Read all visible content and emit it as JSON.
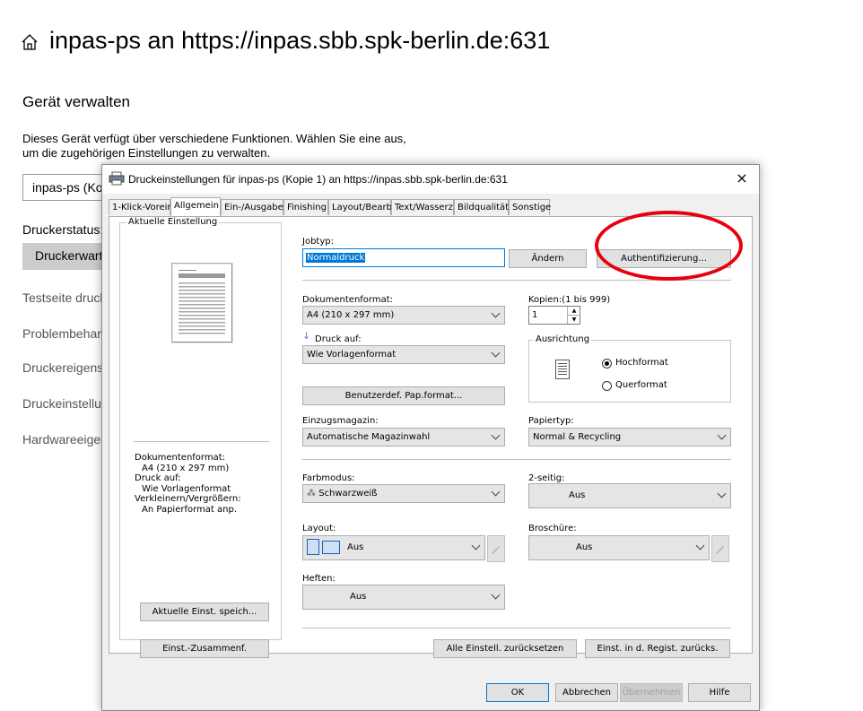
{
  "page": {
    "title": "inpas-ps an https://inpas.sbb.spk-berlin.de:631",
    "section_title": "Gerät verwalten",
    "description_line1": "Dieses Gerät verfügt über verschiedene Funktionen. Wählen Sie eine aus,",
    "description_line2": "um die zugehörigen Einstellungen zu verwalten.",
    "device_select_value": "inpas-ps (Ko",
    "status_label": "Druckerstatus:",
    "status_button": "Druckerwart",
    "links": [
      "Testseite druck",
      "Problembehan",
      "Druckereigens",
      "Druckeinstellu",
      "Hardwareeiger"
    ]
  },
  "dialog": {
    "title": "Druckeinstellungen für inpas-ps (Kopie 1) an https://inpas.sbb.spk-berlin.de:631",
    "close": "×",
    "tabs": [
      "1-Klick-Vorein",
      "Allgemein",
      "Ein-/Ausgabe",
      "Finishing",
      "Layout/Bearb",
      "Text/Wasserz",
      "Bildqualität",
      "Sonstige"
    ],
    "active_tab": "Allgemein",
    "left": {
      "group_title": "Aktuelle Einstellung",
      "summary_lines": [
        "Dokumentenformat:",
        "  A4 (210 x 297 mm)",
        "Druck auf:",
        "  Wie Vorlagenformat",
        "Verkleinern/Vergrößern:",
        "  An Papierformat anp."
      ],
      "save_button": "Aktuelle Einst. speich...",
      "summary_button": "Einst.-Zusammenf."
    },
    "jobtype": {
      "label": "Jobtyp:",
      "value": "Normaldruck",
      "change_button": "Ändern",
      "auth_button": "Authentifizierung..."
    },
    "document_format": {
      "label": "Dokumentenformat:",
      "value": "A4 (210 x 297 mm)"
    },
    "copies": {
      "label": "Kopien:(1 bis 999)",
      "value": "1"
    },
    "print_on": {
      "label": "Druck auf:",
      "value": "Wie Vorlagenformat"
    },
    "orientation": {
      "group_title": "Ausrichtung",
      "portrait": "Hochformat",
      "landscape": "Querformat",
      "selected": "Hochformat"
    },
    "custom_format_button": "Benutzerdef. Pap.format...",
    "tray": {
      "label": "Einzugsmagazin:",
      "value": "Automatische Magazinwahl"
    },
    "paper_type": {
      "label": "Papiertyp:",
      "value": "Normal & Recycling"
    },
    "color_mode": {
      "label": "Farbmodus:",
      "value": "Schwarzweiß"
    },
    "duplex": {
      "label": "2-seitig:",
      "value": "Aus"
    },
    "layout": {
      "label": "Layout:",
      "value": "Aus"
    },
    "booklet": {
      "label": "Broschüre:",
      "value": "Aus"
    },
    "staple": {
      "label": "Heften:",
      "value": "Aus"
    },
    "reset_all_button": "Alle Einstell. zurücksetzen",
    "reset_registry_button": "Einst. in d. Regist. zurücks.",
    "footer": {
      "ok": "OK",
      "cancel": "Abbrechen",
      "apply": "Übernehmen",
      "help": "Hilfe"
    }
  },
  "colors": {
    "highlight": "#e8000b",
    "selection": "#0078d7"
  }
}
